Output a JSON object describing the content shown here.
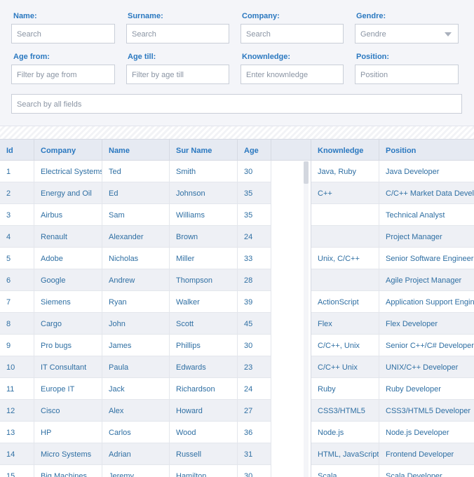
{
  "filters": {
    "name": {
      "label": "Name:",
      "placeholder": "Search"
    },
    "surname": {
      "label": "Surname:",
      "placeholder": "Search"
    },
    "company": {
      "label": "Company:",
      "placeholder": "Search"
    },
    "gendre": {
      "label": "Gendre:",
      "value": "Gendre"
    },
    "age_from": {
      "label": "Age from:",
      "placeholder": "Filter by age from"
    },
    "age_till": {
      "label": "Age till:",
      "placeholder": "Filter by age till"
    },
    "knowledge": {
      "label": "Knownledge:",
      "placeholder": "Enter knownledge"
    },
    "position": {
      "label": "Position:",
      "placeholder": "Position"
    },
    "all_fields": {
      "placeholder": "Search by all fields"
    }
  },
  "grid": {
    "headers": {
      "id": "Id",
      "company": "Company",
      "name": "Name",
      "surname": "Sur Name",
      "age": "Age",
      "knowledge": "Knownledge",
      "position": "Position"
    },
    "rows": [
      {
        "id": "1",
        "company": "Electrical Systems",
        "name": "Ted",
        "surname": "Smith",
        "age": "30",
        "knowledge": "Java, Ruby",
        "position": "Java Developer"
      },
      {
        "id": "2",
        "company": "Energy and Oil",
        "name": "Ed",
        "surname": "Johnson",
        "age": "35",
        "knowledge": "C++",
        "position": "C/C++ Market Data Developer"
      },
      {
        "id": "3",
        "company": "Airbus",
        "name": "Sam",
        "surname": "Williams",
        "age": "35",
        "knowledge": "",
        "position": "Technical Analyst"
      },
      {
        "id": "4",
        "company": "Renault",
        "name": "Alexander",
        "surname": "Brown",
        "age": "24",
        "knowledge": "",
        "position": "Project Manager"
      },
      {
        "id": "5",
        "company": "Adobe",
        "name": "Nicholas",
        "surname": "Miller",
        "age": "33",
        "knowledge": "Unix, C/C++",
        "position": "Senior Software Engineer"
      },
      {
        "id": "6",
        "company": "Google",
        "name": "Andrew",
        "surname": "Thompson",
        "age": "28",
        "knowledge": "",
        "position": "Agile Project Manager"
      },
      {
        "id": "7",
        "company": "Siemens",
        "name": "Ryan",
        "surname": "Walker",
        "age": "39",
        "knowledge": "ActionScript",
        "position": "Application Support Engineer"
      },
      {
        "id": "8",
        "company": "Cargo",
        "name": "John",
        "surname": "Scott",
        "age": "45",
        "knowledge": "Flex",
        "position": "Flex Developer"
      },
      {
        "id": "9",
        "company": "Pro bugs",
        "name": "James",
        "surname": "Phillips",
        "age": "30",
        "knowledge": "C/C++, Unix",
        "position": "Senior C++/C# Developer"
      },
      {
        "id": "10",
        "company": "IT Consultant",
        "name": "Paula",
        "surname": "Edwards",
        "age": "23",
        "knowledge": "C/C++ Unix",
        "position": "UNIX/C++ Developer"
      },
      {
        "id": "11",
        "company": "Europe IT",
        "name": "Jack",
        "surname": "Richardson",
        "age": "24",
        "knowledge": "Ruby",
        "position": "Ruby Developer"
      },
      {
        "id": "12",
        "company": "Cisco",
        "name": "Alex",
        "surname": "Howard",
        "age": "27",
        "knowledge": "CSS3/HTML5",
        "position": "CSS3/HTML5 Developer"
      },
      {
        "id": "13",
        "company": "HP",
        "name": "Carlos",
        "surname": "Wood",
        "age": "36",
        "knowledge": "Node.js",
        "position": "Node.js Developer"
      },
      {
        "id": "14",
        "company": "Micro Systems",
        "name": "Adrian",
        "surname": "Russell",
        "age": "31",
        "knowledge": "HTML, JavaScript",
        "position": "Frontend Developer"
      },
      {
        "id": "15",
        "company": "Big Machines",
        "name": "Jeremy",
        "surname": "Hamilton",
        "age": "30",
        "knowledge": "Scala",
        "position": "Scala Developer"
      }
    ]
  },
  "colors": {
    "accent": "#2a78c0",
    "text": "#2f6fa3",
    "panel_bg": "#f4f5f9",
    "header_bg": "#e6eaf2",
    "row_alt_bg": "#eef0f5"
  },
  "icons": {
    "select_arrow": "chevron-down-icon"
  }
}
